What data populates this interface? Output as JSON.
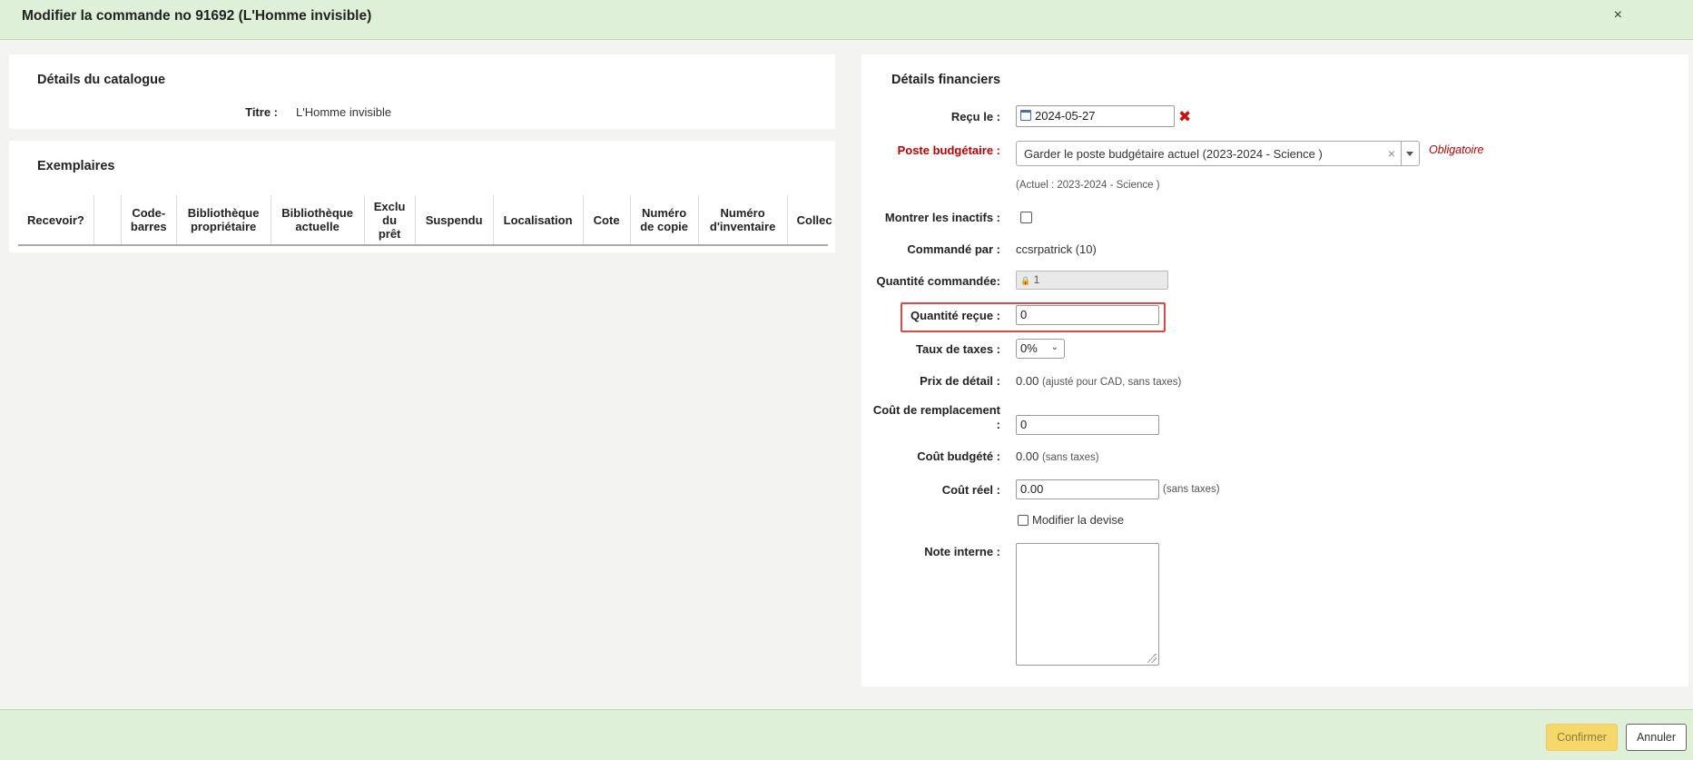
{
  "modal": {
    "title": "Modifier la commande no 91692 (L'Homme invisible)",
    "close": "×"
  },
  "catalog": {
    "heading": "Détails du catalogue",
    "title_label": "Titre :",
    "title_value": "L'Homme invisible"
  },
  "items": {
    "heading": "Exemplaires",
    "columns": [
      "Recevoir?",
      "",
      "Code-barres",
      "Bibliothèque propriétaire",
      "Bibliothèque actuelle",
      "Exclu du prêt",
      "Suspendu",
      "Localisation",
      "Cote",
      "Numéro de copie",
      "Numéro d'inventaire",
      "Collec"
    ]
  },
  "financial": {
    "heading": "Détails financiers",
    "received_label": "Reçu le :",
    "received_value": "2024-05-27",
    "fund_label": "Poste budgétaire :",
    "fund_value": "Garder le poste budgétaire actuel (2023-2024 - Science )",
    "fund_clear": "×",
    "required": "Obligatoire",
    "current_fund": "(Actuel : 2023-2024 - Science )",
    "show_inactive_label": "Montrer les inactifs :",
    "ordered_by_label": "Commandé par :",
    "ordered_by_value": "ccsrpatrick (10)",
    "qty_ordered_label": "Quantité commandée:",
    "qty_ordered_value": "1",
    "qty_received_label": "Quantité reçue :",
    "qty_received_value": "0",
    "tax_label": "Taux de taxes :",
    "tax_value": "0%",
    "retail_label": "Prix de détail :",
    "retail_value": "0.00",
    "retail_note": "(ajusté pour CAD, sans taxes)",
    "replacement_label_1": "Coût de remplacement",
    "replacement_label_2": ":",
    "replacement_value": "0",
    "budgeted_label": "Coût budgété :",
    "budgeted_value": "0.00",
    "budgeted_note": "(sans taxes)",
    "actual_label": "Coût réel :",
    "actual_value": "0.00",
    "actual_note": "(sans taxes)",
    "change_currency_label": "Modifier la devise",
    "internal_note_label": "Note interne :"
  },
  "footer": {
    "confirm": "Confirmer",
    "cancel": "Annuler"
  },
  "colors": {
    "header_bg": "#dff0d8",
    "required_red": "#c00000",
    "highlight": "#e04848",
    "confirm_bg": "#f6d86a"
  }
}
